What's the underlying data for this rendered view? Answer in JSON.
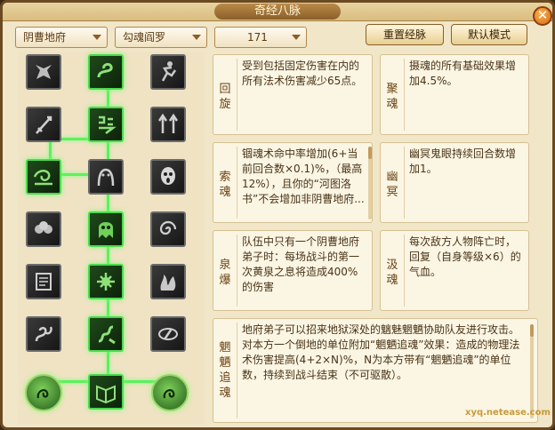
{
  "window": {
    "title": "奇经八脉",
    "close_label": "✕"
  },
  "filters": {
    "school": "阴曹地府",
    "faction": "勾魂阎罗",
    "level": "171"
  },
  "buttons": {
    "reset": "重置经脉",
    "default_mode": "默认模式"
  },
  "tree": {
    "active_nodes": [
      "c1r1",
      "c1r2",
      "c0r3",
      "c1r4",
      "c1r5",
      "c1r6",
      "c1r7",
      "c0r7",
      "c2r7"
    ],
    "icons": [
      "demon-mask-icon",
      "serpent-icon",
      "running-figure-icon",
      "sword-icon",
      "spiral-rune-icon",
      "ghost-arrows-icon",
      "wind-swirl-icon",
      "wailing-spirit-icon",
      "ghost-face-icon",
      "skull-cloud-icon",
      "green-ghost-icon",
      "vortex-icon",
      "scroll-icon",
      "knot-icon",
      "flames-icon",
      "serpent-coil-icon",
      "dragon-icon",
      "shadow-eye-icon",
      "spirit-orb-icon",
      "book-icon",
      "spirit-orb-icon"
    ]
  },
  "cards": [
    {
      "name": "回旋",
      "desc": "受到包括固定伤害在内的所有法术伤害减少65点。"
    },
    {
      "name": "聚魂",
      "desc": "摄魂的所有基础效果增加4.5%。"
    },
    {
      "name": "索魂",
      "desc": "锢魂术命中率增加(6+当前回合数×0.1)%，（最高12%），且你的“河图洛书”不会增加非阴曹地府..."
    },
    {
      "name": "幽冥",
      "desc": "幽冥鬼眼持续回合数增加1。"
    },
    {
      "name": "泉爆",
      "desc": "队伍中只有一个阴曹地府弟子时：每场战斗的第一次黄泉之息将造成400%的伤害"
    },
    {
      "name": "汲魂",
      "desc": "每次敌方人物阵亡时，回复（自身等级×6）的气血。"
    }
  ],
  "big_card": {
    "name": "魍魉追魂",
    "desc": "地府弟子可以招来地狱深处的魑魅魍魉协助队友进行攻击。对本方一个倒地的单位附加“魍魉追魂”效果：造成的物理法术伤害提高(4+2×N)%，N为本方带有“魍魉追魂”的单位数，持续到战斗结束（不可驱散）。"
  },
  "watermark": {
    "text": "xyq.netease.com"
  }
}
